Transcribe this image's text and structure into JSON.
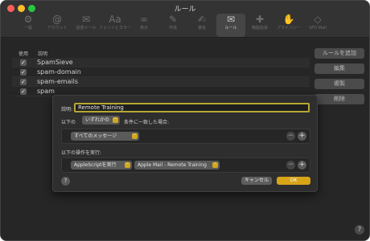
{
  "window": {
    "title": "ルール"
  },
  "toolbar": {
    "items": [
      {
        "label": "一般",
        "icon": "gear-icon",
        "glyph": "⚙"
      },
      {
        "label": "アカウント",
        "icon": "at-icon",
        "glyph": "@"
      },
      {
        "label": "迷惑メール",
        "icon": "junk-mail-icon",
        "glyph": "✉"
      },
      {
        "label": "フォントとカラー",
        "icon": "font-icon",
        "glyph": "Aa"
      },
      {
        "label": "表示",
        "icon": "glasses-icon",
        "glyph": "∞"
      },
      {
        "label": "作成",
        "icon": "compose-icon",
        "glyph": "✎"
      },
      {
        "label": "署名",
        "icon": "signature-icon",
        "glyph": "✍"
      },
      {
        "label": "ルール",
        "icon": "rules-icon",
        "glyph": "✉"
      },
      {
        "label": "機能拡張",
        "icon": "extensions-icon",
        "glyph": "✚"
      },
      {
        "label": "プライバシー",
        "icon": "privacy-icon",
        "glyph": "✋"
      },
      {
        "label": "SFO Mail",
        "icon": "sfo-mail-icon",
        "glyph": "◇"
      }
    ],
    "active_index": 7
  },
  "rules_list": {
    "header_use": "使用",
    "header_desc": "説明",
    "rows": [
      {
        "name": "SpamSieve",
        "enabled": true
      },
      {
        "name": "spam-domain",
        "enabled": true
      },
      {
        "name": "spam-emails",
        "enabled": true
      },
      {
        "name": "spam",
        "enabled": true
      }
    ],
    "checkmark": "✓"
  },
  "side_buttons": {
    "add": "ルールを追加",
    "edit": "編集",
    "duplicate": "複製",
    "remove": "削除"
  },
  "help_glyph": "?",
  "sheet": {
    "desc_label": "説明:",
    "desc_value": "Remote Training",
    "condition_prefix": "以下の",
    "condition_select": "いずれかの",
    "condition_suffix": "条件に一致した場合:",
    "condition_row_select": "すべてのメッセージ",
    "actions_label": "以下の操作を実行:",
    "action_type_select": "AppleScriptを実行",
    "action_target_select": "Apple Mail - Remote Training",
    "minus_glyph": "−",
    "plus_glyph": "+",
    "chevron_glyph": "⌃",
    "cancel": "キャンセル",
    "ok": "OK"
  },
  "colors": {
    "accent": "#d8a417",
    "focus_ring": "#b8a832"
  }
}
